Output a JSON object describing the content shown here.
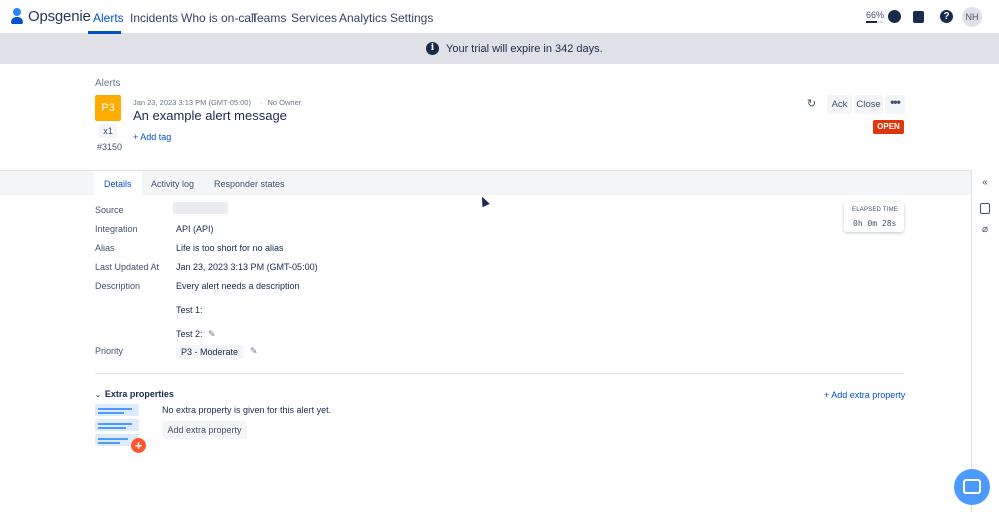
{
  "nav": {
    "brand": "Opsgenie",
    "links": [
      "Alerts",
      "Incidents",
      "Who is on-call",
      "Teams",
      "Services",
      "Analytics",
      "Settings"
    ],
    "progress_label": "66%",
    "progress_fraction": 0.66,
    "avatar_initials": "NH",
    "help_glyph": "?"
  },
  "banner": {
    "text": "Your trial will expire in 342 days.",
    "icon_glyph": "i"
  },
  "alert": {
    "breadcrumb": "Alerts",
    "priority_badge": "P3",
    "count": "x1",
    "tiny_id": "#3150",
    "created": "Jan 23, 2023 3:13 PM (GMT-05:00)",
    "owner": "No Owner",
    "title": "An example alert message",
    "add_tag": "+ Add tag",
    "status": "OPEN",
    "actions": {
      "ack": "Ack",
      "close": "Close",
      "more": "•••"
    }
  },
  "tabs": [
    "Details",
    "Activity log",
    "Responder states"
  ],
  "details": {
    "labels": {
      "source": "Source",
      "integration": "Integration",
      "alias": "Alias",
      "last_updated": "Last Updated At",
      "description": "Description",
      "priority": "Priority"
    },
    "integration": "API (API)",
    "alias": "Life is too short for no alias",
    "last_updated": "Jan 23, 2023 3:13 PM (GMT-05:00)",
    "description_lines": [
      "Every alert needs a description",
      "Test 1:",
      "Test 2:"
    ],
    "priority": "P3 - Moderate"
  },
  "elapsed": {
    "label": "ELAPSED TIME",
    "value": "0h 0m 28s"
  },
  "extra": {
    "heading": "Extra properties",
    "add_link": "+ Add extra property",
    "empty_text": "No extra property is given for this alert yet.",
    "add_button": "Add extra property"
  },
  "colors": {
    "accent": "#0052cc",
    "priority_p3": "#ffab00",
    "status_open": "#de350b",
    "banner_bg": "#dfe1e6"
  }
}
